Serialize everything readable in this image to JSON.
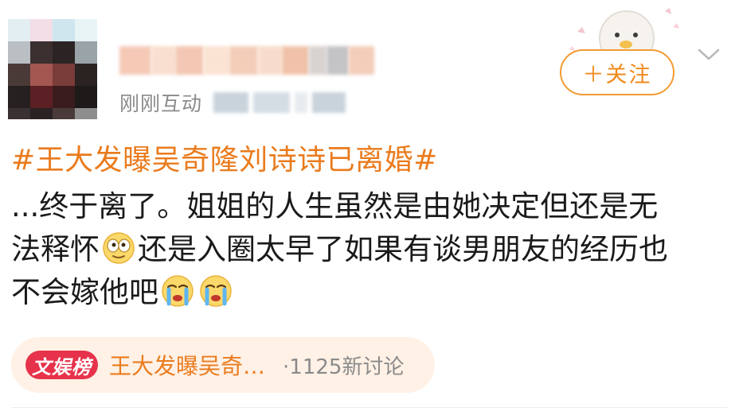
{
  "post": {
    "meta": {
      "time": "刚刚互动"
    },
    "follow_label": "＋关注",
    "topic": "#王大发曝吴奇隆刘诗诗已离婚#",
    "lines": [
      "...终于离了。姐姐的人生虽然是由她决定但还是无",
      "法释怀",
      "还是入圈太早了如果有谈男朋友的经历也",
      "不会嫁他吧"
    ],
    "emojis": {
      "after_line2": "doge-face-icon",
      "line4": [
        "crying-face-icon",
        "crying-face-icon"
      ]
    },
    "topic_card": {
      "badge": "文娱榜",
      "title": "王大发曝吴奇…",
      "count": "·1125新讨论"
    }
  },
  "colors": {
    "accent": "#ea7b1d",
    "badge": "#e6334b",
    "card_bg": "#fff1e6",
    "follow_border": "#f29b32"
  }
}
